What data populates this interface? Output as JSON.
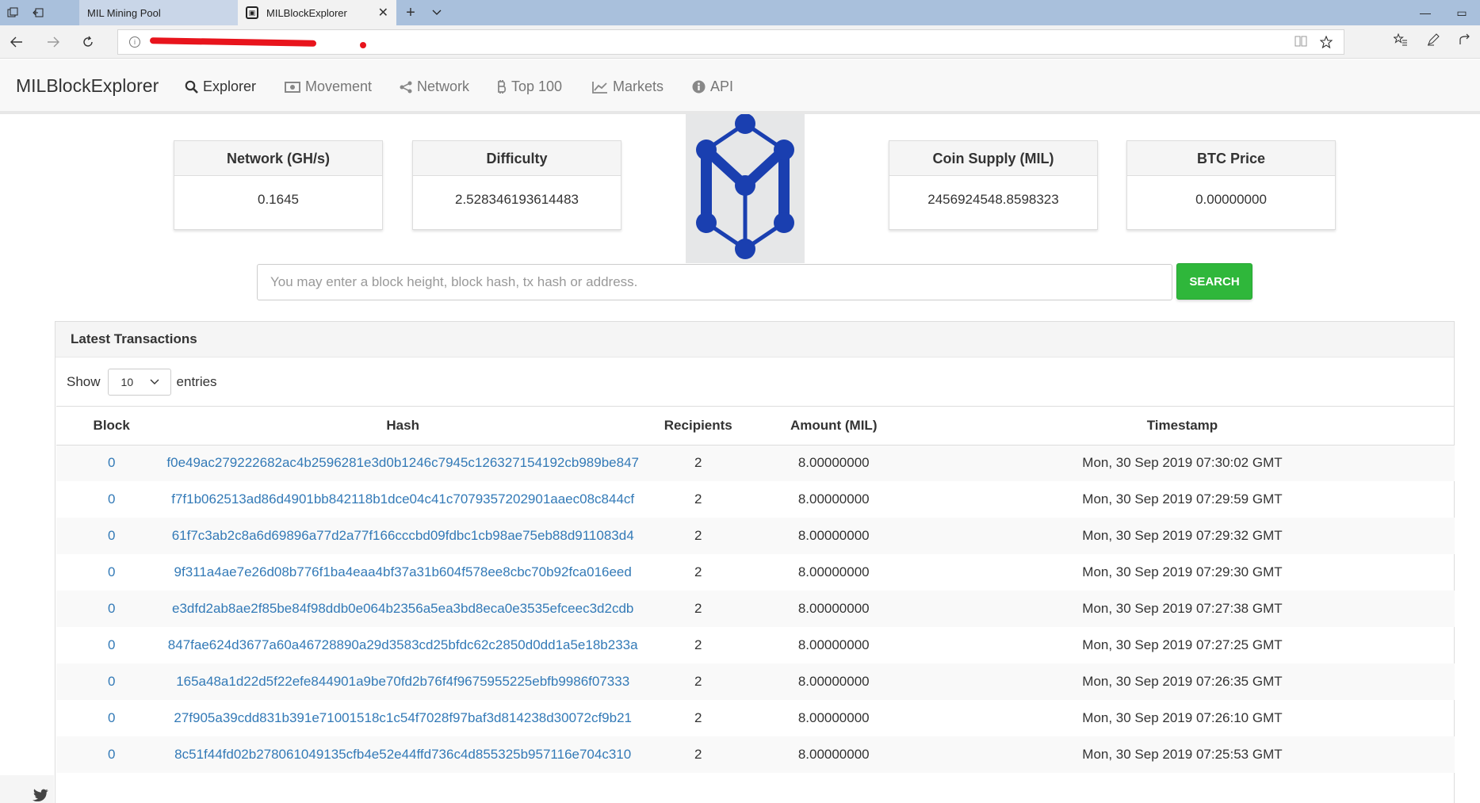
{
  "browser": {
    "tabs": [
      {
        "title": "MIL Mining Pool",
        "active": false
      },
      {
        "title": "MILBlockExplorer",
        "active": true
      }
    ],
    "tab_close_glyph": "✕",
    "new_tab_glyph": "+"
  },
  "navbar": {
    "brand": "MILBlockExplorer",
    "items": [
      {
        "label": "Explorer",
        "icon": "search-icon",
        "active": true
      },
      {
        "label": "Movement",
        "icon": "money-icon",
        "active": false
      },
      {
        "label": "Network",
        "icon": "share-icon",
        "active": false
      },
      {
        "label": "Top 100",
        "icon": "bitcoin-icon",
        "active": false
      },
      {
        "label": "Markets",
        "icon": "line-chart-icon",
        "active": false
      },
      {
        "label": "API",
        "icon": "info-circle-icon",
        "active": false
      }
    ]
  },
  "stats": [
    {
      "title": "Network (GH/s)",
      "value": "0.1645"
    },
    {
      "title": "Difficulty",
      "value": "2.528346193614483"
    },
    {
      "title": "Coin Supply (MIL)",
      "value": "2456924548.8598323"
    },
    {
      "title": "BTC Price",
      "value": "0.00000000"
    }
  ],
  "search": {
    "placeholder": "You may enter a block height, block hash, tx hash or address.",
    "button_label": "SEARCH"
  },
  "transactions": {
    "panel_title": "Latest Transactions",
    "show_label": "Show",
    "entries_label": "entries",
    "page_length": "10",
    "columns": [
      "Block",
      "Hash",
      "Recipients",
      "Amount (MIL)",
      "Timestamp"
    ],
    "rows": [
      {
        "block": "0",
        "hash": "f0e49ac279222682ac4b2596281e3d0b1246c7945c126327154192cb989be847",
        "recipients": "2",
        "amount": "8.00000000",
        "timestamp": "Mon, 30 Sep 2019 07:30:02 GMT"
      },
      {
        "block": "0",
        "hash": "f7f1b062513ad86d4901bb842118b1dce04c41c7079357202901aaec08c844cf",
        "recipients": "2",
        "amount": "8.00000000",
        "timestamp": "Mon, 30 Sep 2019 07:29:59 GMT"
      },
      {
        "block": "0",
        "hash": "61f7c3ab2c8a6d69896a77d2a77f166cccbd09fdbc1cb98ae75eb88d911083d4",
        "recipients": "2",
        "amount": "8.00000000",
        "timestamp": "Mon, 30 Sep 2019 07:29:32 GMT"
      },
      {
        "block": "0",
        "hash": "9f311a4ae7e26d08b776f1ba4eaa4bf37a31b604f578ee8cbc70b92fca016eed",
        "recipients": "2",
        "amount": "8.00000000",
        "timestamp": "Mon, 30 Sep 2019 07:29:30 GMT"
      },
      {
        "block": "0",
        "hash": "e3dfd2ab8ae2f85be84f98ddb0e064b2356a5ea3bd8eca0e3535efceec3d2cdb",
        "recipients": "2",
        "amount": "8.00000000",
        "timestamp": "Mon, 30 Sep 2019 07:27:38 GMT"
      },
      {
        "block": "0",
        "hash": "847fae624d3677a60a46728890a29d3583cd25bfdc62c2850d0dd1a5e18b233a",
        "recipients": "2",
        "amount": "8.00000000",
        "timestamp": "Mon, 30 Sep 2019 07:27:25 GMT"
      },
      {
        "block": "0",
        "hash": "165a48a1d22d5f22efe844901a9be70fd2b76f4f9675955225ebfb9986f07333",
        "recipients": "2",
        "amount": "8.00000000",
        "timestamp": "Mon, 30 Sep 2019 07:26:35 GMT"
      },
      {
        "block": "0",
        "hash": "27f905a39cdd831b391e71001518c1c54f7028f97baf3d814238d30072cf9b21",
        "recipients": "2",
        "amount": "8.00000000",
        "timestamp": "Mon, 30 Sep 2019 07:26:10 GMT"
      },
      {
        "block": "0",
        "hash": "8c51f44fd02b278061049135cfb4e52e44ffd736c4d855325b957116e704c310",
        "recipients": "2",
        "amount": "8.00000000",
        "timestamp": "Mon, 30 Sep 2019 07:25:53 GMT"
      }
    ]
  },
  "colors": {
    "link": "#337ab7",
    "search_button": "#2fb73b",
    "logo_blue": "#1a3fb0"
  }
}
